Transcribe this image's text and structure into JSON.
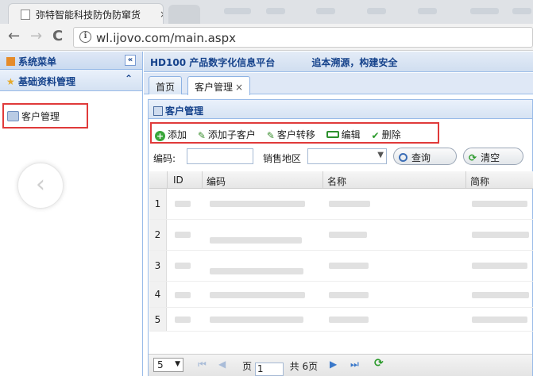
{
  "browser": {
    "tab_title": "弥特智能科技防伪防窜货",
    "tab_close": "×",
    "url": "wl.ijovo.com/main.aspx",
    "back": "←",
    "forward": "→",
    "reload": "C",
    "info": "i"
  },
  "sidebar": {
    "title": "系统菜单",
    "collapse": "«",
    "section": "基础资料管理",
    "section_toggle": "⌃",
    "item": "客户管理",
    "back_nav": "‹"
  },
  "header": {
    "title": "HD100 产品数字化信息平台",
    "slogan": "追本溯源，构建安全"
  },
  "tabs": [
    {
      "label": "首页"
    },
    {
      "label": "客户管理",
      "close": "×"
    }
  ],
  "panel": {
    "title": "客户管理",
    "toolbar": {
      "add": "添加",
      "add_child": "添加子客户",
      "transfer": "客户转移",
      "edit": "编辑",
      "delete": "删除"
    },
    "search": {
      "code_label": "编码:",
      "code_value": "",
      "region_label": "销售地区",
      "region_value": "",
      "query_button": "查询",
      "clear_button": "清空"
    },
    "grid": {
      "columns": [
        "ID",
        "编码",
        "名称",
        "简称"
      ],
      "rows": [
        "1",
        "2",
        "3",
        "4",
        "5"
      ]
    },
    "pager": {
      "page_size": "5",
      "page_label": "页",
      "page_value": "1",
      "total_label": "共 6页"
    }
  }
}
